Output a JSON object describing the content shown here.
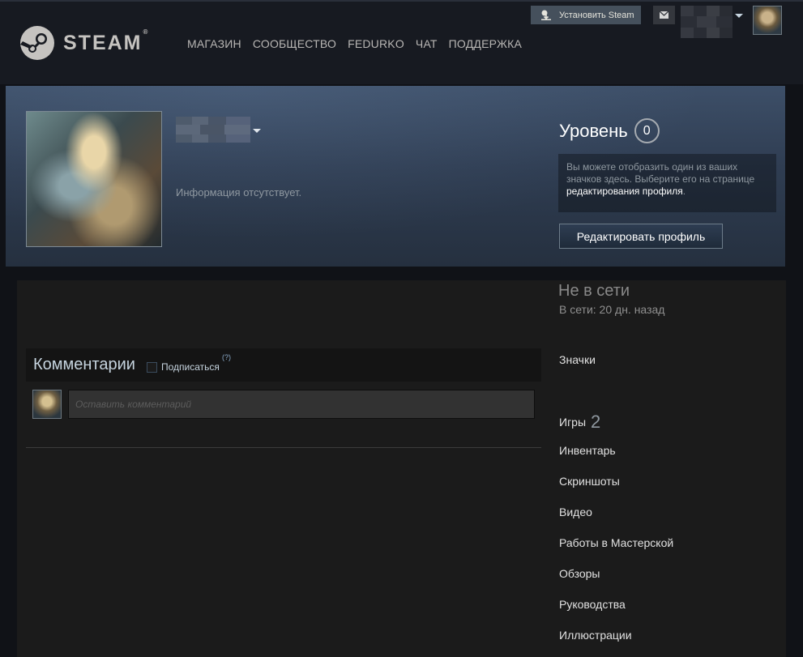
{
  "header": {
    "logo_text": "STEAM",
    "logo_reg": "®",
    "nav": [
      "МАГАЗИН",
      "СООБЩЕСТВО",
      "FEDURKO",
      "ЧАТ",
      "ПОДДЕРЖКА"
    ],
    "install_label": "Установить Steam",
    "mail_icon": "envelope-icon"
  },
  "profile": {
    "summary": "Информация отсутствует.",
    "level_label": "Уровень",
    "level_value": "0",
    "badge_note_text": "Вы можете отобразить один из ваших значков здесь. Выберите его на странице ",
    "badge_note_link": "редактирования профиля",
    "badge_note_end": ".",
    "edit_button": "Редактировать профиль"
  },
  "status": {
    "state": "Не в сети",
    "last_online": "В сети: 20 дн. назад"
  },
  "comments": {
    "title": "Комментарии",
    "subscribe": "Подписаться",
    "help": "(?)",
    "placeholder": "Оставить комментарий"
  },
  "sidebar": {
    "badges": "Значки",
    "games": "Игры",
    "games_count": "2",
    "inventory": "Инвентарь",
    "screenshots": "Скриншоты",
    "videos": "Видео",
    "workshop": "Работы в Мастерской",
    "reviews": "Обзоры",
    "guides": "Руководства",
    "artwork": "Иллюстрации"
  }
}
